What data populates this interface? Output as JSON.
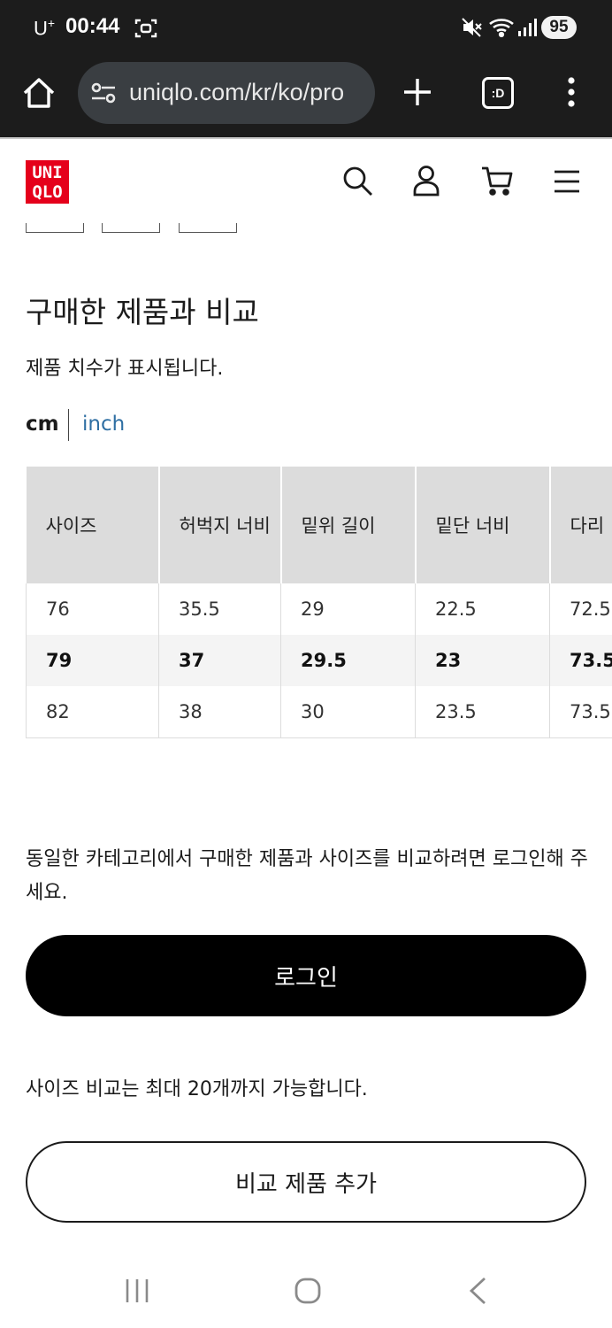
{
  "status_bar": {
    "carrier": "U",
    "carrier_sup": "+",
    "time": "00:44",
    "battery": "95",
    "icons": [
      "screen-record-icon",
      "mute-icon",
      "wifi-icon",
      "signal-icon"
    ]
  },
  "browser": {
    "url": "uniqlo.com/kr/ko/pro",
    "tabs_label": ":D",
    "icons": [
      "home-icon",
      "tune-icon",
      "plus-icon",
      "more-vert-icon"
    ]
  },
  "header": {
    "logo_line1": "UNI",
    "logo_line2": "QLO",
    "icons": [
      "search-icon",
      "user-icon",
      "cart-icon",
      "menu-icon"
    ]
  },
  "colors": {
    "brand_red": "#e5001b",
    "link_blue": "#2f6fa3",
    "header_dark": "#1c1c1c"
  },
  "section": {
    "title": "구매한 제품과 비교",
    "subtitle": "제품 치수가 표시됩니다.",
    "unit_cm": "cm",
    "unit_inch": "inch"
  },
  "size_table": {
    "headers": [
      "사이즈",
      "허벅지 너비",
      "밑위 길이",
      "밑단 너비",
      "다리"
    ],
    "rows": [
      [
        "76",
        "35.5",
        "29",
        "22.5",
        "72.5"
      ],
      [
        "79",
        "37",
        "29.5",
        "23",
        "73.5"
      ],
      [
        "82",
        "38",
        "30",
        "23.5",
        "73.5"
      ]
    ]
  },
  "login": {
    "note": "동일한 카테고리에서 구매한 제품과 사이즈를 비교하려면 로그인해 주세요.",
    "button": "로그인"
  },
  "compare": {
    "note": "사이즈 비교는 최대 20개까지 가능합니다.",
    "button": "비교 제품 추가"
  }
}
